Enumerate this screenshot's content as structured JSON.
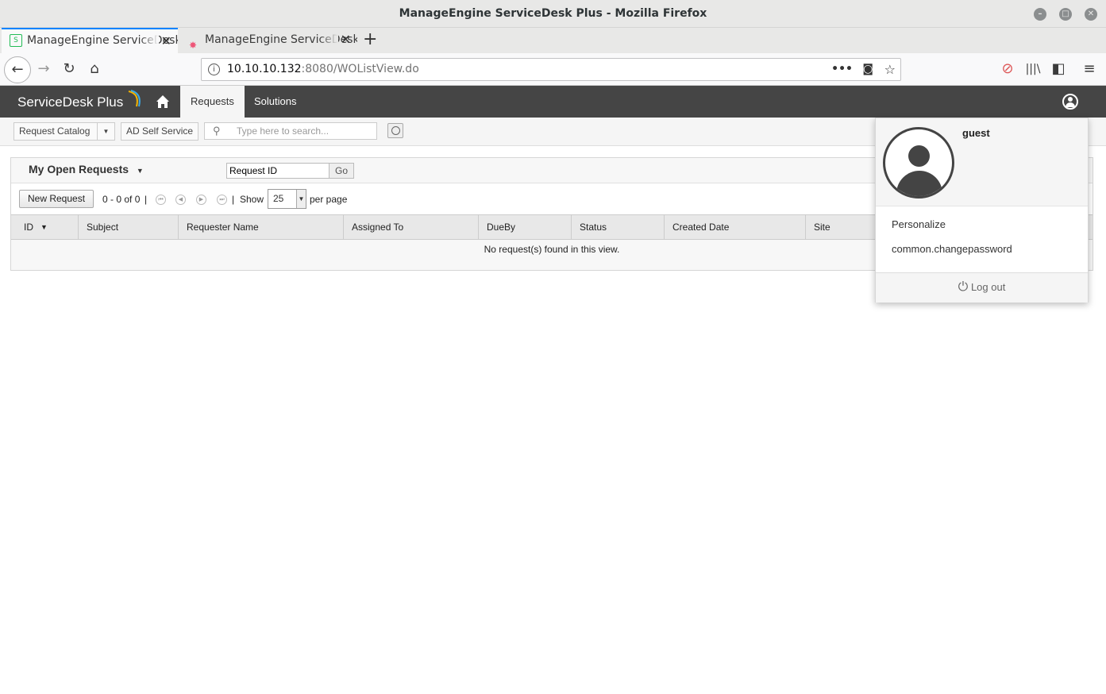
{
  "window": {
    "title": "ManageEngine ServiceDesk Plus - Mozilla Firefox"
  },
  "browser": {
    "tabs": [
      {
        "label": "ManageEngine ServiceDesk Plus",
        "active": true
      },
      {
        "label": "ManageEngine ServiceDesk Plus",
        "active": false
      }
    ],
    "url_host": "10.10.10.132",
    "url_rest": ":8080/WOListView.do"
  },
  "app": {
    "logo": "ServiceDesk Plus",
    "nav_tabs": [
      "Requests",
      "Solutions"
    ],
    "toolbar": {
      "request_catalog": "Request Catalog",
      "ad_self_service": "AD Self Service",
      "search_placeholder": "Type here to search..."
    },
    "view": {
      "title": "My Open Requests",
      "request_id_value": "Request ID",
      "go_label": "Go",
      "new_request": "New Request",
      "range": "0 - 0 of 0",
      "show_label": "Show",
      "per_page_value": "25",
      "per_page_label": "per page",
      "columns": [
        "ID",
        "Subject",
        "Requester Name",
        "Assigned To",
        "DueBy",
        "Status",
        "Created Date",
        "Site"
      ],
      "empty_message": "No request(s) found in this view."
    },
    "user_menu": {
      "username": "guest",
      "items": [
        "Personalize",
        "common.changepassword"
      ],
      "logout": "Log out"
    }
  }
}
